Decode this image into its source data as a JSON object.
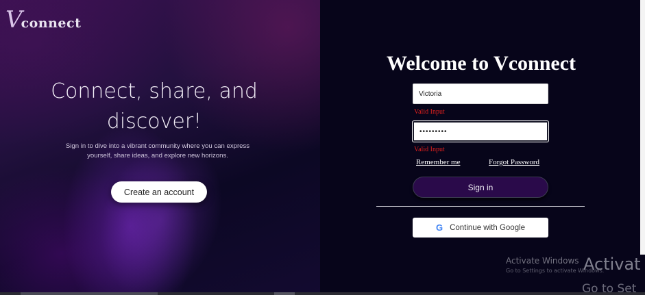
{
  "brand": {
    "logo_letter": "V",
    "logo_text": "connect"
  },
  "hero": {
    "title": "Connect, share, and discover!",
    "subtitle": "Sign in to dive into a vibrant community where you can express yourself, share ideas, and explore new horizons.",
    "create_account_label": "Create an account"
  },
  "login": {
    "heading": "Welcome to Vconnect",
    "username_value": "Victoria",
    "username_validation": "Valid Input",
    "password_value": "•••••••••",
    "password_validation": "Valid Input",
    "remember_label": "Remember me",
    "forgot_label": "Forgot Password",
    "signin_label": "Sign in",
    "google_label": "Continue with Google",
    "google_icon": "G"
  },
  "watermark": {
    "title": "Activate Windows",
    "subtitle": "Go to Settings to activate Windows.",
    "title_large": "Activat",
    "subtitle_large": "Go to Set"
  },
  "colors": {
    "validation": "#e0201e",
    "form_bg": "#07051a",
    "signin_bg": "#2a0a4a"
  }
}
